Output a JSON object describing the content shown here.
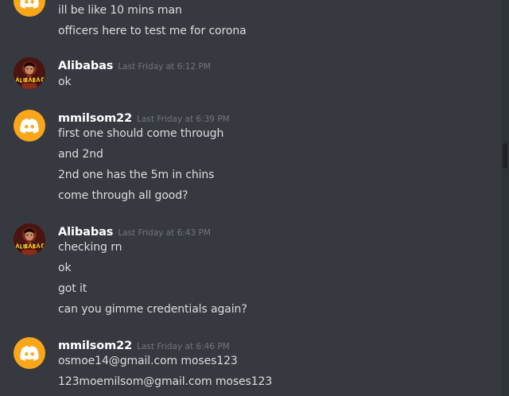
{
  "messages": [
    {
      "continuation": true,
      "avatar": "discord-logo-icon",
      "lines": [
        "ill be like 10 mins man",
        "officers here to test me for corona"
      ]
    },
    {
      "username": "Alibabas",
      "timestamp": "Last Friday at 6:12 PM",
      "avatar": "alibabas-avatar",
      "lines": [
        "ok"
      ]
    },
    {
      "username": "mmilsom22",
      "timestamp": "Last Friday at 6:39 PM",
      "avatar": "discord-logo-icon",
      "lines": [
        "first one should come through",
        "and 2nd",
        "2nd one has the 5m in chins",
        "come through all good?"
      ]
    },
    {
      "username": "Alibabas",
      "timestamp": "Last Friday at 6:43 PM",
      "avatar": "alibabas-avatar",
      "lines": [
        "checking rn",
        "ok",
        "got it",
        "can you gimme credentials again?"
      ]
    },
    {
      "username": "mmilsom22",
      "timestamp": "Last Friday at 6:46 PM",
      "avatar": "discord-logo-icon",
      "lines": [
        "osmoe14@gmail.com moses123",
        "123moemilsom@gmail.com moses123"
      ]
    }
  ],
  "colors": {
    "background": "#36393f",
    "username": "#ffffff",
    "timestamp": "#72767d",
    "message_text": "#dcddde",
    "discord_avatar": "#faa61a"
  }
}
